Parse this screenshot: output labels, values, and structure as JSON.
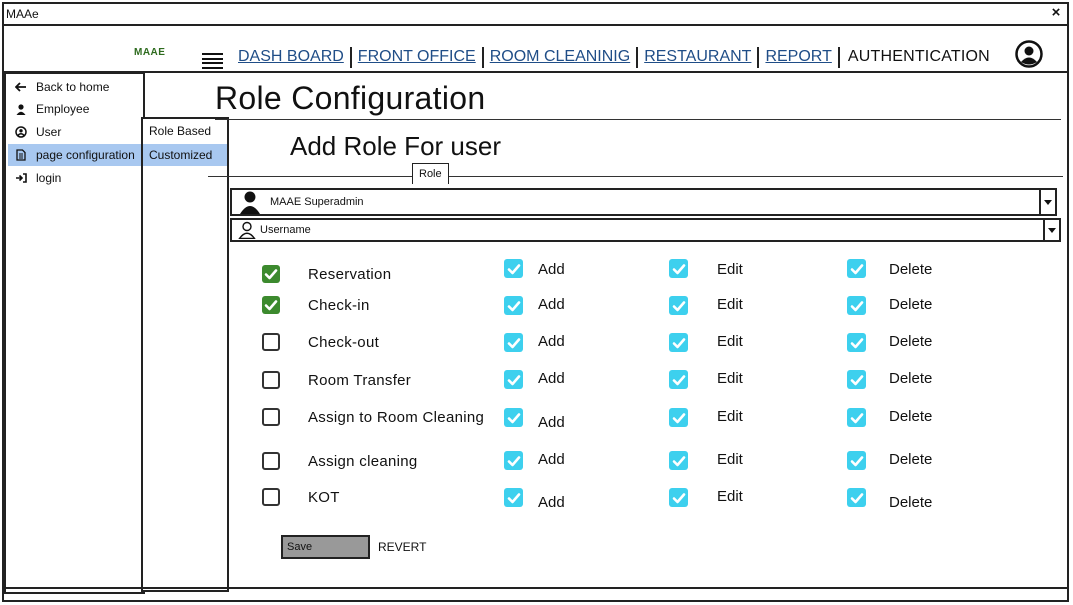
{
  "window": {
    "title": "MAAe",
    "close_glyph": "×"
  },
  "header": {
    "logo_text": "MAAE",
    "nav": [
      {
        "label": "DASH BOARD"
      },
      {
        "label": "FRONT OFFICE"
      },
      {
        "label": "ROOM CLEANINIG"
      },
      {
        "label": "RESTAURANT"
      },
      {
        "label": "REPORT"
      }
    ],
    "active_nav": "AUTHENTICATION"
  },
  "sidebar": {
    "items": [
      {
        "label": "Back to home",
        "icon": "arrow-left-icon"
      },
      {
        "label": "Employee",
        "icon": "person-icon"
      },
      {
        "label": "User",
        "icon": "user-circle-icon"
      },
      {
        "label": "page configuration",
        "icon": "document-icon",
        "active": true
      },
      {
        "label": "login",
        "icon": "login-icon"
      }
    ]
  },
  "submenu": {
    "items": [
      {
        "label": "Role Based"
      },
      {
        "label": "Customized",
        "active": true
      }
    ]
  },
  "main": {
    "page_title": "Role Configuration",
    "section_title": "Add Role For user",
    "role_tab": "Role",
    "role_select": {
      "value": "MAAE Superadmin",
      "icon": "user-silhouette-icon"
    },
    "user_select": {
      "value": "Username",
      "icon": "user-outline-icon"
    },
    "permissions": [
      {
        "name": "Reservation",
        "checked": true,
        "add": "Add",
        "edit": "Edit",
        "delete": "Delete"
      },
      {
        "name": "Check-in",
        "checked": true,
        "add": "Add",
        "edit": "Edit",
        "delete": "Delete"
      },
      {
        "name": "Check-out",
        "checked": false,
        "add": "Add",
        "edit": "Edit",
        "delete": "Delete"
      },
      {
        "name": "Room Transfer",
        "checked": false,
        "add": "Add",
        "edit": "Edit",
        "delete": "Delete"
      },
      {
        "name": "Assign to Room Cleaning",
        "checked": false,
        "add": "Add",
        "edit": "Edit",
        "delete": "Delete"
      },
      {
        "name": "Assign cleaning",
        "checked": false,
        "add": "Add",
        "edit": "Edit",
        "delete": "Delete"
      },
      {
        "name": "KOT",
        "checked": false,
        "add": "Add",
        "edit": "Edit",
        "delete": "Delete"
      }
    ],
    "save_label": "Save",
    "revert_label": "REVERT"
  },
  "colors": {
    "checked_green": "#3c8a2e",
    "sub_check_cyan": "#3dd0ee",
    "active_highlight": "#a8c8f0",
    "nav_link_blue": "#1f4d87"
  }
}
